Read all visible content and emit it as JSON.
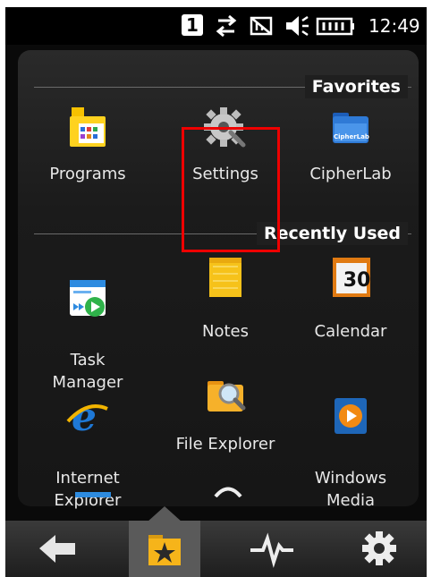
{
  "status": {
    "badge": "1",
    "time": "12:49"
  },
  "sections": {
    "favorites": "Favorites",
    "recent": "Recently Used"
  },
  "favorites": [
    {
      "label": "Programs"
    },
    {
      "label": "Settings"
    },
    {
      "label": "CipherLab"
    }
  ],
  "recent": [
    {
      "label": "Task\nManager"
    },
    {
      "label": "Notes"
    },
    {
      "label": "Calendar"
    },
    {
      "label": "Internet\nExplorer"
    },
    {
      "label": "File Explorer"
    },
    {
      "label": "Windows\nMedia"
    }
  ],
  "calendar_day": "30",
  "cipherlab_logo": "CipherLab",
  "colors": {
    "highlight": "#e00000",
    "accent": "#f5b800"
  },
  "icons": {
    "bottombar": [
      "back-arrow-icon",
      "favorites-star-icon",
      "pulse-icon",
      "gear-icon"
    ]
  }
}
